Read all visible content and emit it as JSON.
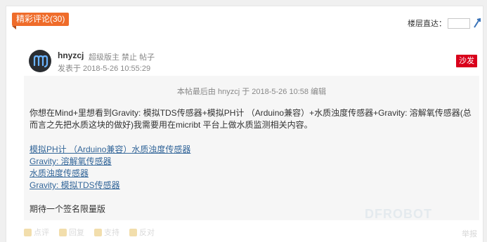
{
  "section": {
    "tag": "精彩评论(30)"
  },
  "jump": {
    "label": "楼层直达："
  },
  "post": {
    "author": "hnyzcj",
    "role": "超级版主  禁止  帖子",
    "time": "发表于 2018-5-26 10:55:29",
    "badge": "沙发",
    "edit_note": "本帖最后由 hnyzcj 于 2018-5-26 10:58 编辑",
    "paragraph": "你想在Mind+里想看到Gravity: 模拟TDS传感器+模拟PH计 （Arduino兼容）+水质浊度传感器+Gravity: 溶解氧传感器(总而言之先把水质这块的做好)我需要用在micribt 平台上做水质监测相关内容。",
    "links": [
      "模拟PH计 （Arduino兼容）水质浊度传感器",
      "Gravity: 溶解氧传感器",
      "水质浊度传感器",
      "Gravity: 模拟TDS传感器"
    ],
    "closing": "期待一个签名限量版"
  },
  "actions": {
    "rate": "点评",
    "reply": "回复",
    "support": "支持",
    "oppose": "反对",
    "report": "举报"
  },
  "watermark": "DFROBOT"
}
